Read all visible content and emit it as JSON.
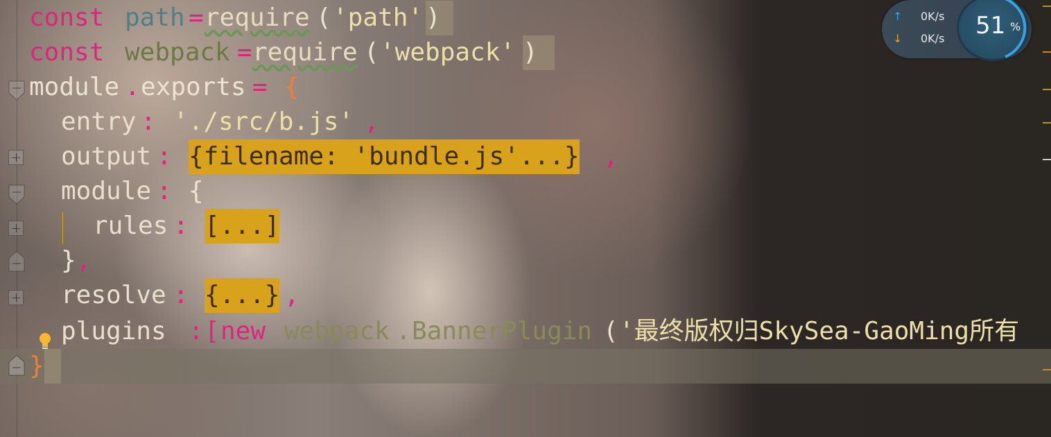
{
  "code": {
    "line1": {
      "kw": "const",
      "var": "path",
      "op": "=",
      "fn": "require",
      "open": "(",
      "str": "'path'",
      "close": ")"
    },
    "line2": {
      "kw": "const",
      "var": "webpack",
      "op": "=",
      "fn": "require",
      "open": "(",
      "str": "'webpack'",
      "close": ")"
    },
    "line3": {
      "obj": "module",
      "dot": ".",
      "prop": "exports",
      "op": "=",
      "brace": "{"
    },
    "line4": {
      "key": "entry",
      "colon": ":",
      "str": "'./src/b.js'",
      "comma": ","
    },
    "line5": {
      "key": "output",
      "colon": ":",
      "folded": "{filename: 'bundle.js'...}",
      "comma": ","
    },
    "line6": {
      "key": "module",
      "colon": ":",
      "brace": "{"
    },
    "line7": {
      "key": "rules",
      "colon": ":",
      "folded": "[...]"
    },
    "line8": {
      "close": "}",
      "comma": ","
    },
    "line9": {
      "key": "resolve",
      "colon": ":",
      "folded": "{...}",
      "comma": ","
    },
    "line10": {
      "key": "plugins",
      "colon": ":",
      "bracket": "[",
      "kw": "new",
      "obj": "webpack",
      "dot": ".",
      "cls": "BannerPlugin",
      "paren": "(",
      "str": "'最终版权归SkySea-GaoMing所有"
    },
    "line11": {
      "close": "}"
    }
  },
  "net_widget": {
    "upload_arrow": "↑",
    "upload_speed": "0K/s",
    "download_arrow": "↓",
    "download_speed": "0K/s",
    "cpu_percent": "51",
    "cpu_unit": "%"
  },
  "colors": {
    "keyword": "#e0247e",
    "fold_highlight": "#d8a21a",
    "upload_arrow": "#3aa0e8",
    "download_arrow": "#f0a020"
  },
  "icons": [
    "fold-expand-icon",
    "fold-collapse-icon",
    "lightbulb-icon",
    "upload-arrow-icon",
    "download-arrow-icon"
  ]
}
